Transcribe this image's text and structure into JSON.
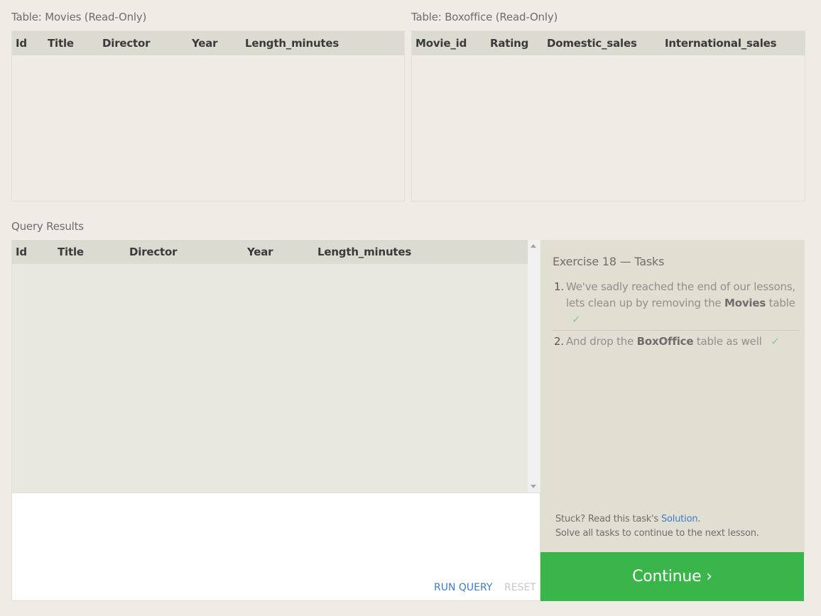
{
  "movies_table": {
    "caption": "Table: Movies (Read-Only)",
    "columns": [
      "Id",
      "Title",
      "Director",
      "Year",
      "Length_minutes"
    ]
  },
  "boxoffice_table": {
    "caption": "Table: Boxoffice (Read-Only)",
    "columns": [
      "Movie_id",
      "Rating",
      "Domestic_sales",
      "International_sales"
    ]
  },
  "results": {
    "caption": "Query Results",
    "columns": [
      "Id",
      "Title",
      "Director",
      "Year",
      "Length_minutes"
    ]
  },
  "editor": {
    "run_label": "RUN QUERY",
    "reset_label": "RESET"
  },
  "tasks": {
    "title": "Exercise 18 — Tasks",
    "items": [
      {
        "number": "1.",
        "pre": "We've sadly reached the end of our lessons, lets clean up by removing the ",
        "bold": "Movies",
        "post": " table",
        "check": "✓"
      },
      {
        "number": "2.",
        "pre": "And drop the ",
        "bold": "BoxOffice",
        "post": " table as well",
        "check": "✓"
      }
    ],
    "hint_pre": "Stuck? Read this task's ",
    "hint_link": "Solution",
    "hint_post": ".",
    "hint_line2": "Solve all tasks to continue to the next lesson."
  },
  "continue_label": "Continue ›",
  "colors": {
    "accent_green": "#3ab54a",
    "link_blue": "#3a7bd5",
    "check_green": "#8cca8c"
  }
}
